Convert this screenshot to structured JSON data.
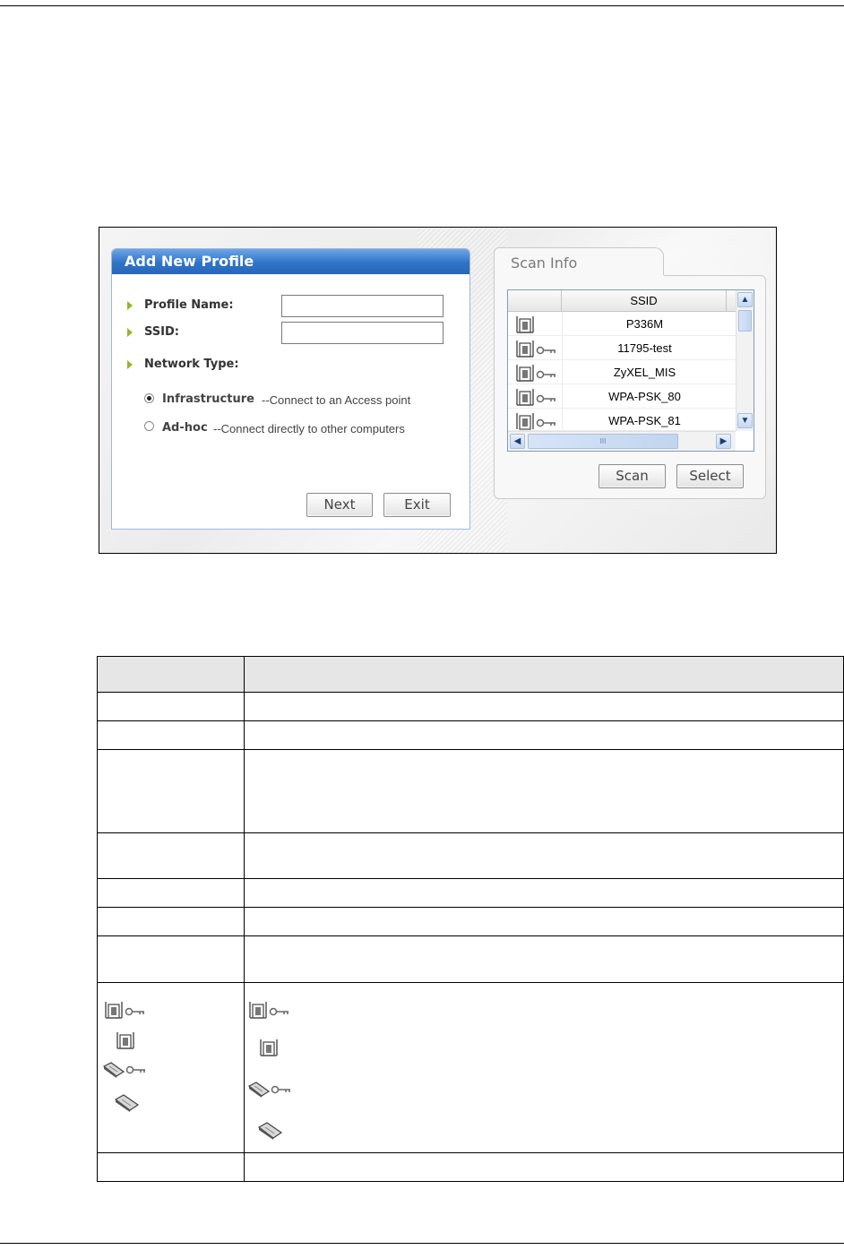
{
  "dialog": {
    "title": "Add New Profile",
    "profile_name_label": "Profile Name:",
    "profile_name_value": "",
    "ssid_label": "SSID:",
    "ssid_value": "",
    "network_type_label": "Network Type:",
    "infrastructure_label": "Infrastructure",
    "infrastructure_desc": "--Connect to an Access point",
    "adhoc_label": "Ad-hoc",
    "adhoc_desc": "--Connect directly to other computers",
    "selected_network_type": "Infrastructure",
    "next_label": "Next",
    "exit_label": "Exit"
  },
  "scan": {
    "tab_label": "Scan Info",
    "column_header": "SSID",
    "rows": [
      {
        "ssid": "P336M",
        "icon": "access-point-icon",
        "secured": false
      },
      {
        "ssid": "11795-test",
        "icon": "access-point-icon",
        "secured": true
      },
      {
        "ssid": "ZyXEL_MIS",
        "icon": "access-point-icon",
        "secured": true
      },
      {
        "ssid": "WPA-PSK_80",
        "icon": "access-point-icon",
        "secured": true
      },
      {
        "ssid": "WPA-PSK_81",
        "icon": "access-point-icon",
        "secured": true
      }
    ],
    "hscroll_grip": "III",
    "scan_label": "Scan",
    "select_label": "Select"
  },
  "legend_icons": [
    {
      "name": "access-point-secured-icon"
    },
    {
      "name": "access-point-icon"
    },
    {
      "name": "ad-hoc-secured-icon"
    },
    {
      "name": "ad-hoc-icon"
    }
  ],
  "colors": {
    "title_bar": "#2f73c8",
    "bullet": "#8bbb2a",
    "key": "#8a8a8a"
  }
}
